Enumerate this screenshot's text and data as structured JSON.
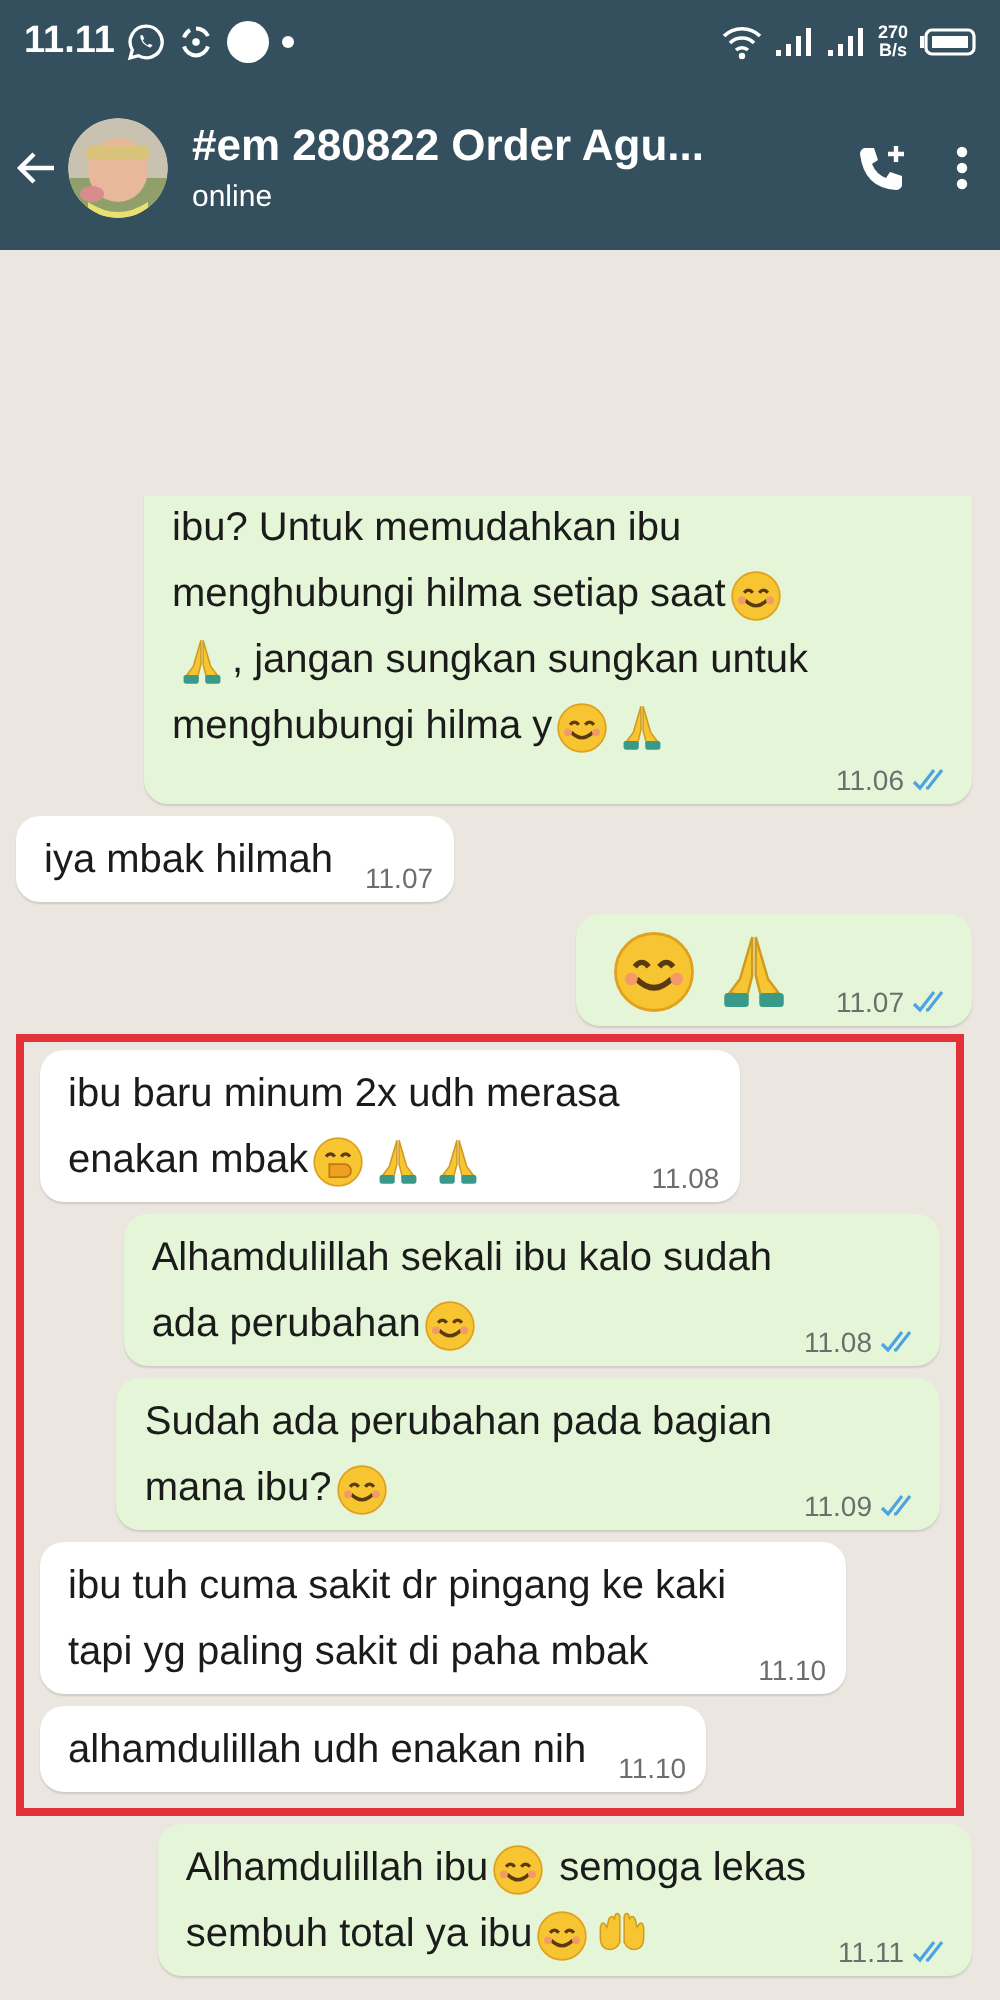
{
  "status_bar": {
    "time": "11.11",
    "speed": "270",
    "speed_unit": "B/s"
  },
  "header": {
    "title": "#em 280822 Order Agu...",
    "subtitle": "online"
  },
  "message_groups": [
    {
      "highlighted": false,
      "messages": [
        {
          "kind": "outgoing",
          "cut_off_top": true,
          "read": true,
          "time": "11.06",
          "lines": [
            [
              {
                "kind": "text",
                "text": "ibu? Untuk memudahkan ibu"
              }
            ],
            [
              {
                "kind": "text",
                "text": "menghubungi hilma setiap saat"
              },
              {
                "kind": "smile"
              }
            ],
            [
              {
                "kind": "pray"
              },
              {
                "kind": "text",
                "text": ", jangan sungkan sungkan untuk"
              }
            ],
            [
              {
                "kind": "text",
                "text": "menghubungi hilma y"
              },
              {
                "kind": "smile"
              },
              {
                "kind": "pray"
              }
            ]
          ]
        },
        {
          "kind": "incoming",
          "cut_off_top": false,
          "time": "11.07",
          "lines": [
            [
              {
                "kind": "text",
                "text": "iya mbak hilmah"
              }
            ]
          ]
        },
        {
          "kind": "outgoing",
          "cut_off_top": false,
          "read": true,
          "time": "11.07",
          "lines": [
            [
              {
                "kind": "big-smile"
              },
              {
                "kind": "big-pray"
              }
            ]
          ]
        }
      ]
    },
    {
      "highlighted": true,
      "messages": [
        {
          "kind": "incoming",
          "cut_off_top": false,
          "time": "11.08",
          "lines": [
            [
              {
                "kind": "text",
                "text": "ibu baru minum 2x udh merasa"
              }
            ],
            [
              {
                "kind": "text",
                "text": "enakan mbak"
              },
              {
                "kind": "giggle"
              },
              {
                "kind": "pray"
              },
              {
                "kind": "pray"
              }
            ]
          ]
        },
        {
          "kind": "outgoing",
          "cut_off_top": false,
          "read": true,
          "time": "11.08",
          "lines": [
            [
              {
                "kind": "text",
                "text": "Alhamdulillah sekali ibu kalo sudah"
              }
            ],
            [
              {
                "kind": "text",
                "text": "ada perubahan"
              },
              {
                "kind": "smile"
              }
            ]
          ]
        },
        {
          "kind": "outgoing",
          "cut_off_top": false,
          "read": true,
          "time": "11.09",
          "lines": [
            [
              {
                "kind": "text",
                "text": "Sudah ada perubahan pada bagian"
              }
            ],
            [
              {
                "kind": "text",
                "text": "mana ibu?"
              },
              {
                "kind": "smile"
              }
            ]
          ]
        },
        {
          "kind": "incoming",
          "cut_off_top": false,
          "time": "11.10",
          "lines": [
            [
              {
                "kind": "text",
                "text": "ibu tuh cuma sakit dr pingang ke kaki"
              }
            ],
            [
              {
                "kind": "text",
                "text": "tapi yg paling sakit di paha mbak"
              }
            ]
          ]
        },
        {
          "kind": "incoming",
          "cut_off_top": false,
          "time": "11.10",
          "lines": [
            [
              {
                "kind": "text",
                "text": "alhamdulillah udh enakan nih"
              }
            ]
          ]
        }
      ]
    },
    {
      "highlighted": false,
      "messages": [
        {
          "kind": "outgoing",
          "cut_off_top": false,
          "read": true,
          "time": "11.11",
          "lines": [
            [
              {
                "kind": "text",
                "text": "Alhamdulillah ibu"
              },
              {
                "kind": "smile"
              },
              {
                "kind": "text",
                "text": " semoga lekas"
              }
            ],
            [
              {
                "kind": "text",
                "text": "sembuh total ya ibu"
              },
              {
                "kind": "smile"
              },
              {
                "kind": "hands"
              }
            ]
          ]
        }
      ]
    }
  ]
}
